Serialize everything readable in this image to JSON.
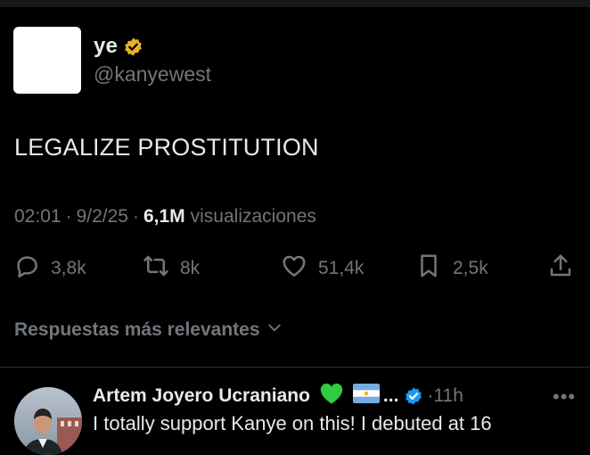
{
  "tweet": {
    "display_name": "ye",
    "handle": "@kanyewest",
    "verified_icon": "gold-verified-badge-icon",
    "text": "LEGALIZE PROSTITUTION",
    "time": "02:01",
    "date": "9/2/25",
    "separator": "·",
    "views_count": "6,1M",
    "views_label": "visualizaciones"
  },
  "actions": {
    "replies": "3,8k",
    "reposts": "8k",
    "likes": "51,4k",
    "bookmarks": "2,5k"
  },
  "replies_section": {
    "heading": "Respuestas más relevantes"
  },
  "reply": {
    "name": "Artem Joyero Ucraniano",
    "emojis": [
      "green-heart-emoji",
      "argentina-flag-emoji"
    ],
    "ellipsis": "...",
    "separator": "·",
    "time": "11h",
    "more": "•••",
    "text": "I totally support Kanye on this! I debuted at 16"
  },
  "colors": {
    "background": "#000000",
    "text_primary": "#e7e9ea",
    "text_secondary": "#71767b",
    "gold_badge": "#e6b325",
    "blue_badge": "#1d9bf0",
    "green_heart": "#2ecc40"
  }
}
